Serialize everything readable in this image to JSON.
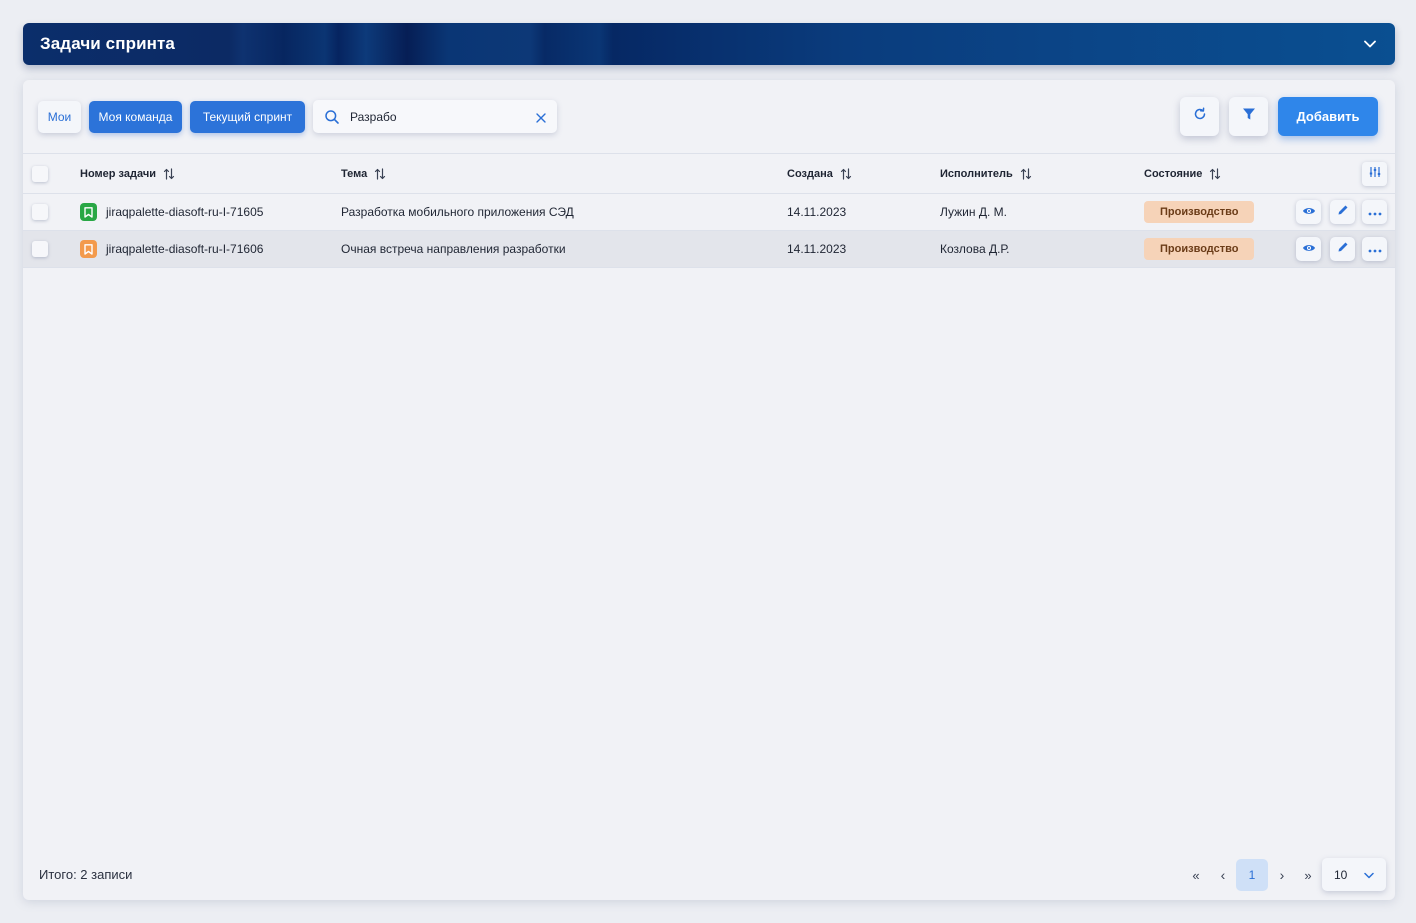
{
  "header": {
    "title": "Задачи спринта"
  },
  "toolbar": {
    "chips": {
      "mine": "Мои",
      "team": "Моя команда",
      "sprint": "Текущий спринт"
    },
    "search_value": "Разрабо",
    "add_label": "Добавить"
  },
  "table": {
    "columns": {
      "number": "Номер задачи",
      "topic": "Тема",
      "created": "Создана",
      "assignee": "Исполнитель",
      "status": "Состояние"
    },
    "rows": [
      {
        "number": "jiraqpalette-diasoft-ru-I-71605",
        "topic": "Разработка мобильного приложения СЭД",
        "created": "14.11.2023",
        "assignee": "Лужин Д. М.",
        "status": "Производство"
      },
      {
        "number": "jiraqpalette-diasoft-ru-I-71606",
        "topic": "Очная встреча направления разработки",
        "created": "14.11.2023",
        "assignee": "Козлова Д.Р.",
        "status": "Производство"
      }
    ]
  },
  "footer": {
    "total": "Итого: 2 записи",
    "pager": {
      "first": "«",
      "prev": "‹",
      "current": "1",
      "next": "›",
      "last": "»"
    },
    "page_size": "10"
  },
  "colors": {
    "accent": "#2c73d9",
    "header_dark": "#0b2e6b",
    "status_badge": "#f6d3b8"
  }
}
